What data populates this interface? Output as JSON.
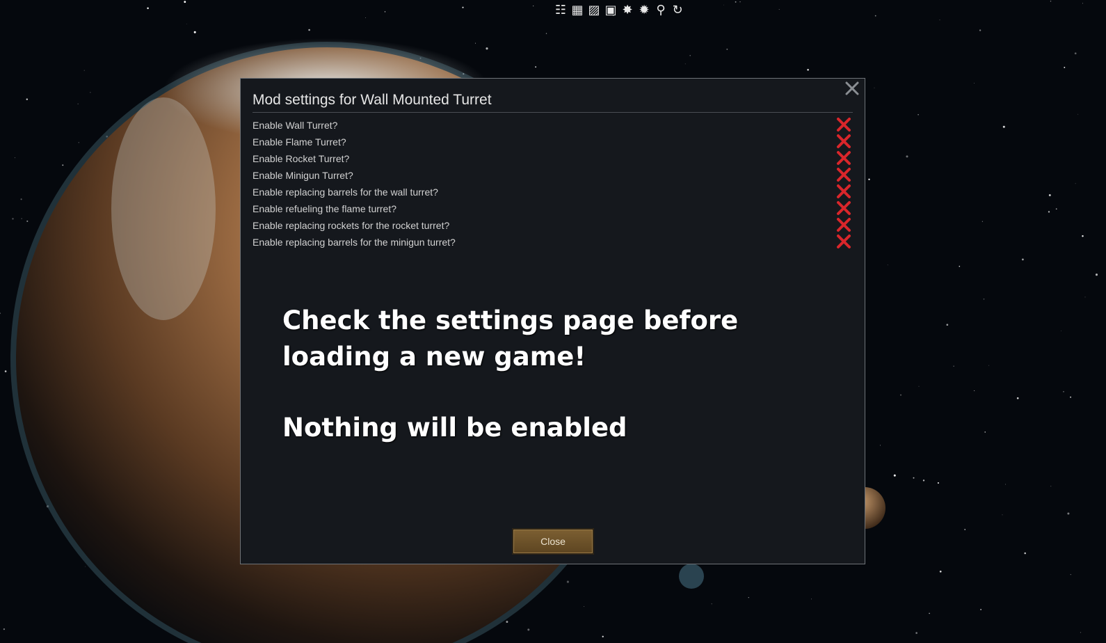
{
  "toolbar": {
    "icons": [
      "list-icon",
      "grid-icon",
      "windows-icon",
      "layers-icon",
      "star-gear-icon",
      "star-gear-alt-icon",
      "search-icon",
      "refresh-icon"
    ]
  },
  "dialog": {
    "title": "Mod settings for Wall Mounted Turret",
    "settings": [
      {
        "label": "Enable Wall Turret?",
        "enabled": false
      },
      {
        "label": "Enable Flame Turret?",
        "enabled": false
      },
      {
        "label": "Enable Rocket Turret?",
        "enabled": false
      },
      {
        "label": "Enable Minigun Turret?",
        "enabled": false
      },
      {
        "label": "Enable replacing barrels for the wall turret?",
        "enabled": false
      },
      {
        "label": "Enable refueling the flame turret?",
        "enabled": false
      },
      {
        "label": "Enable replacing rockets for the rocket turret?",
        "enabled": false
      },
      {
        "label": "Enable replacing barrels for the minigun turret?",
        "enabled": false
      }
    ],
    "notice_line1": "Check the settings page before",
    "notice_line2": "loading a new game!",
    "notice_line3": "Nothing will be enabled",
    "close_label": "Close"
  },
  "colors": {
    "dialog_bg": "#15181d",
    "x_mark": "#d9262b",
    "button": "#6e5329"
  }
}
